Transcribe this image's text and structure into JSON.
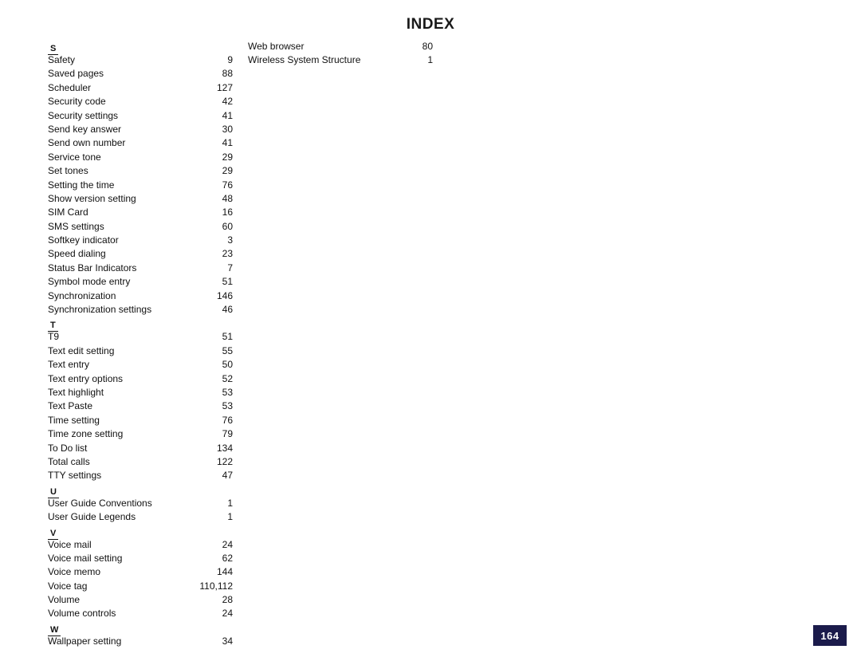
{
  "page": {
    "title": "INDEX",
    "page_number": "164"
  },
  "columns": [
    {
      "name": "left",
      "blocks": [
        {
          "letter": "S",
          "entries": [
            {
              "label": "Safety",
              "page": "9"
            },
            {
              "label": "Saved pages",
              "page": "88"
            },
            {
              "label": "Scheduler",
              "page": "127"
            },
            {
              "label": "Security code",
              "page": "42"
            },
            {
              "label": "Security settings",
              "page": "41"
            },
            {
              "label": "Send key answer",
              "page": "30"
            },
            {
              "label": "Send own number",
              "page": "41"
            },
            {
              "label": "Service tone",
              "page": "29"
            },
            {
              "label": "Set tones",
              "page": "29"
            },
            {
              "label": "Setting the time",
              "page": "76"
            },
            {
              "label": "Show version setting",
              "page": "48"
            },
            {
              "label": "SIM Card",
              "page": "16"
            },
            {
              "label": "SMS settings",
              "page": "60"
            },
            {
              "label": "Softkey indicator",
              "page": "3"
            },
            {
              "label": "Speed dialing",
              "page": "23"
            },
            {
              "label": "Status Bar Indicators",
              "page": "7"
            },
            {
              "label": "Symbol mode entry",
              "page": "51"
            },
            {
              "label": "Synchronization",
              "page": "146"
            },
            {
              "label": "Synchronization settings",
              "page": "46"
            }
          ]
        },
        {
          "letter": "T",
          "entries": [
            {
              "label": "T9",
              "page": "51"
            },
            {
              "label": "Text edit setting",
              "page": "55"
            },
            {
              "label": "Text entry",
              "page": "50"
            },
            {
              "label": "Text entry options",
              "page": "52"
            },
            {
              "label": "Text highlight",
              "page": "53"
            },
            {
              "label": "Text Paste",
              "page": "53"
            },
            {
              "label": "Time setting",
              "page": "76"
            },
            {
              "label": "Time zone setting",
              "page": "79"
            },
            {
              "label": "To Do list",
              "page": "134"
            },
            {
              "label": "Total calls",
              "page": "122"
            },
            {
              "label": "TTY settings",
              "page": "47"
            }
          ]
        },
        {
          "letter": "U",
          "entries": [
            {
              "label": "User Guide Conventions",
              "page": "1"
            },
            {
              "label": "User Guide Legends",
              "page": "1"
            }
          ]
        },
        {
          "letter": "V",
          "entries": [
            {
              "label": "Voice mail",
              "page": "24"
            },
            {
              "label": "Voice mail setting",
              "page": "62"
            },
            {
              "label": "Voice memo",
              "page": "144"
            },
            {
              "label": "Voice tag",
              "page": "110,112"
            },
            {
              "label": "Volume",
              "page": "28"
            },
            {
              "label": "Volume controls",
              "page": "24"
            }
          ]
        },
        {
          "letter": "W",
          "entries": [
            {
              "label": "Wallpaper setting",
              "page": "34"
            }
          ]
        }
      ]
    },
    {
      "name": "right",
      "blocks": [
        {
          "letter": "",
          "entries": [
            {
              "label": "Web browser",
              "page": "80"
            },
            {
              "label": "Wireless System Structure",
              "page": "1"
            }
          ]
        }
      ]
    }
  ]
}
